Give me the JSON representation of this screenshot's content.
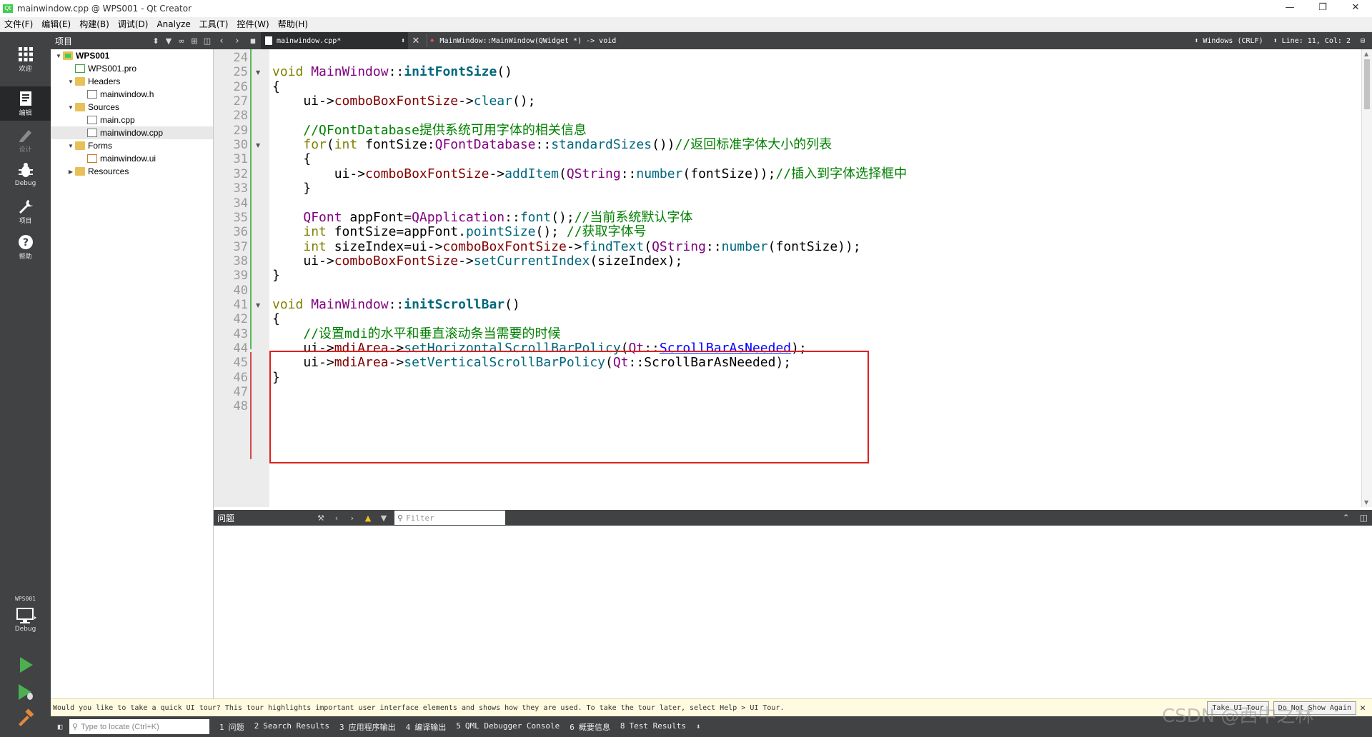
{
  "window": {
    "title": "mainwindow.cpp @ WPS001 - Qt Creator",
    "app_icon": "qt",
    "controls": [
      "—",
      "❐",
      "✕"
    ]
  },
  "menu": [
    "文件(F)",
    "编辑(E)",
    "构建(B)",
    "调试(D)",
    "Analyze",
    "工具(T)",
    "控件(W)",
    "帮助(H)"
  ],
  "modes": [
    {
      "label": "欢迎",
      "icon": "grid-icon"
    },
    {
      "label": "编辑",
      "icon": "edit-icon"
    },
    {
      "label": "设计",
      "icon": "pencil-icon"
    },
    {
      "label": "Debug",
      "icon": "bug-icon"
    },
    {
      "label": "项目",
      "icon": "wrench-icon"
    },
    {
      "label": "帮助",
      "icon": "help-icon"
    }
  ],
  "kit": {
    "project": "WPS001",
    "label": "Debug"
  },
  "project_pane": {
    "title": "项目"
  },
  "tree": [
    {
      "label": "WPS001",
      "depth": 0,
      "expanded": true,
      "icon": "project-folder",
      "bold": true
    },
    {
      "label": "WPS001.pro",
      "depth": 1,
      "icon": "pro-file"
    },
    {
      "label": "Headers",
      "depth": 1,
      "expanded": true,
      "icon": "folder"
    },
    {
      "label": "mainwindow.h",
      "depth": 2,
      "icon": "h-file"
    },
    {
      "label": "Sources",
      "depth": 1,
      "expanded": true,
      "icon": "folder"
    },
    {
      "label": "main.cpp",
      "depth": 2,
      "icon": "cpp-file"
    },
    {
      "label": "mainwindow.cpp",
      "depth": 2,
      "icon": "cpp-file",
      "selected": true
    },
    {
      "label": "Forms",
      "depth": 1,
      "expanded": true,
      "icon": "folder"
    },
    {
      "label": "mainwindow.ui",
      "depth": 2,
      "icon": "ui-file"
    },
    {
      "label": "Resources",
      "depth": 1,
      "expanded": false,
      "icon": "folder"
    }
  ],
  "editor": {
    "file_tab": "mainwindow.cpp*",
    "symbol": "MainWindow::MainWindow(QWidget *) -> void",
    "line_ending": "Windows (CRLF)",
    "position": "Line: 11, Col: 2"
  },
  "line_numbers": [
    "24",
    "25",
    "26",
    "27",
    "28",
    "29",
    "30",
    "31",
    "32",
    "33",
    "34",
    "35",
    "36",
    "37",
    "38",
    "39",
    "40",
    "41",
    "42",
    "43",
    "44",
    "45",
    "46",
    "47",
    "48"
  ],
  "code_lines": [
    "",
    "void MainWindow::initFontSize()",
    "{",
    "    ui->comboBoxFontSize->clear();",
    "",
    "    //QFontDatabase提供系统可用字体的相关信息",
    "    for(int fontSize:QFontDatabase::standardSizes())//返回标准字体大小的列表",
    "    {",
    "        ui->comboBoxFontSize->addItem(QString::number(fontSize));//插入到字体选择框中",
    "    }",
    "",
    "    QFont appFont=QApplication::font();//当前系统默认字体",
    "    int fontSize=appFont.pointSize(); //获取字体号",
    "    int sizeIndex=ui->comboBoxFontSize->findText(QString::number(fontSize));",
    "    ui->comboBoxFontSize->setCurrentIndex(sizeIndex);",
    "}",
    "",
    "void MainWindow::initScrollBar()",
    "{",
    "    //设置mdi的水平和垂直滚动条当需要的时候",
    "    ui->mdiArea->setHorizontalScrollBarPolicy(Qt::ScrollBarAsNeeded);",
    "    ui->mdiArea->setVerticalScrollBarPolicy(Qt::ScrollBarAsNeeded);",
    "}",
    "",
    ""
  ],
  "issues": {
    "title": "问题",
    "filter_placeholder": "Filter"
  },
  "tour": {
    "message": "Would you like to take a quick UI tour? This tour highlights important user interface elements and shows how they are used. To take the tour later, select Help > UI Tour.",
    "take_label": "Take UI Tour",
    "dismiss_label": "Do Not Show Again"
  },
  "status": {
    "locator_placeholder": "Type to locate (Ctrl+K)",
    "panes": [
      {
        "n": "1",
        "label": "问题"
      },
      {
        "n": "2",
        "label": "Search Results"
      },
      {
        "n": "3",
        "label": "应用程序输出"
      },
      {
        "n": "4",
        "label": "编译输出"
      },
      {
        "n": "5",
        "label": "QML Debugger Console"
      },
      {
        "n": "6",
        "label": "概要信息"
      },
      {
        "n": "8",
        "label": "Test Results"
      }
    ]
  },
  "watermark": "CSDN @西中之林",
  "colors": {
    "accent_red": "#e02020",
    "sidebar": "#404244",
    "keyword": "#808000",
    "comment": "#008000"
  }
}
